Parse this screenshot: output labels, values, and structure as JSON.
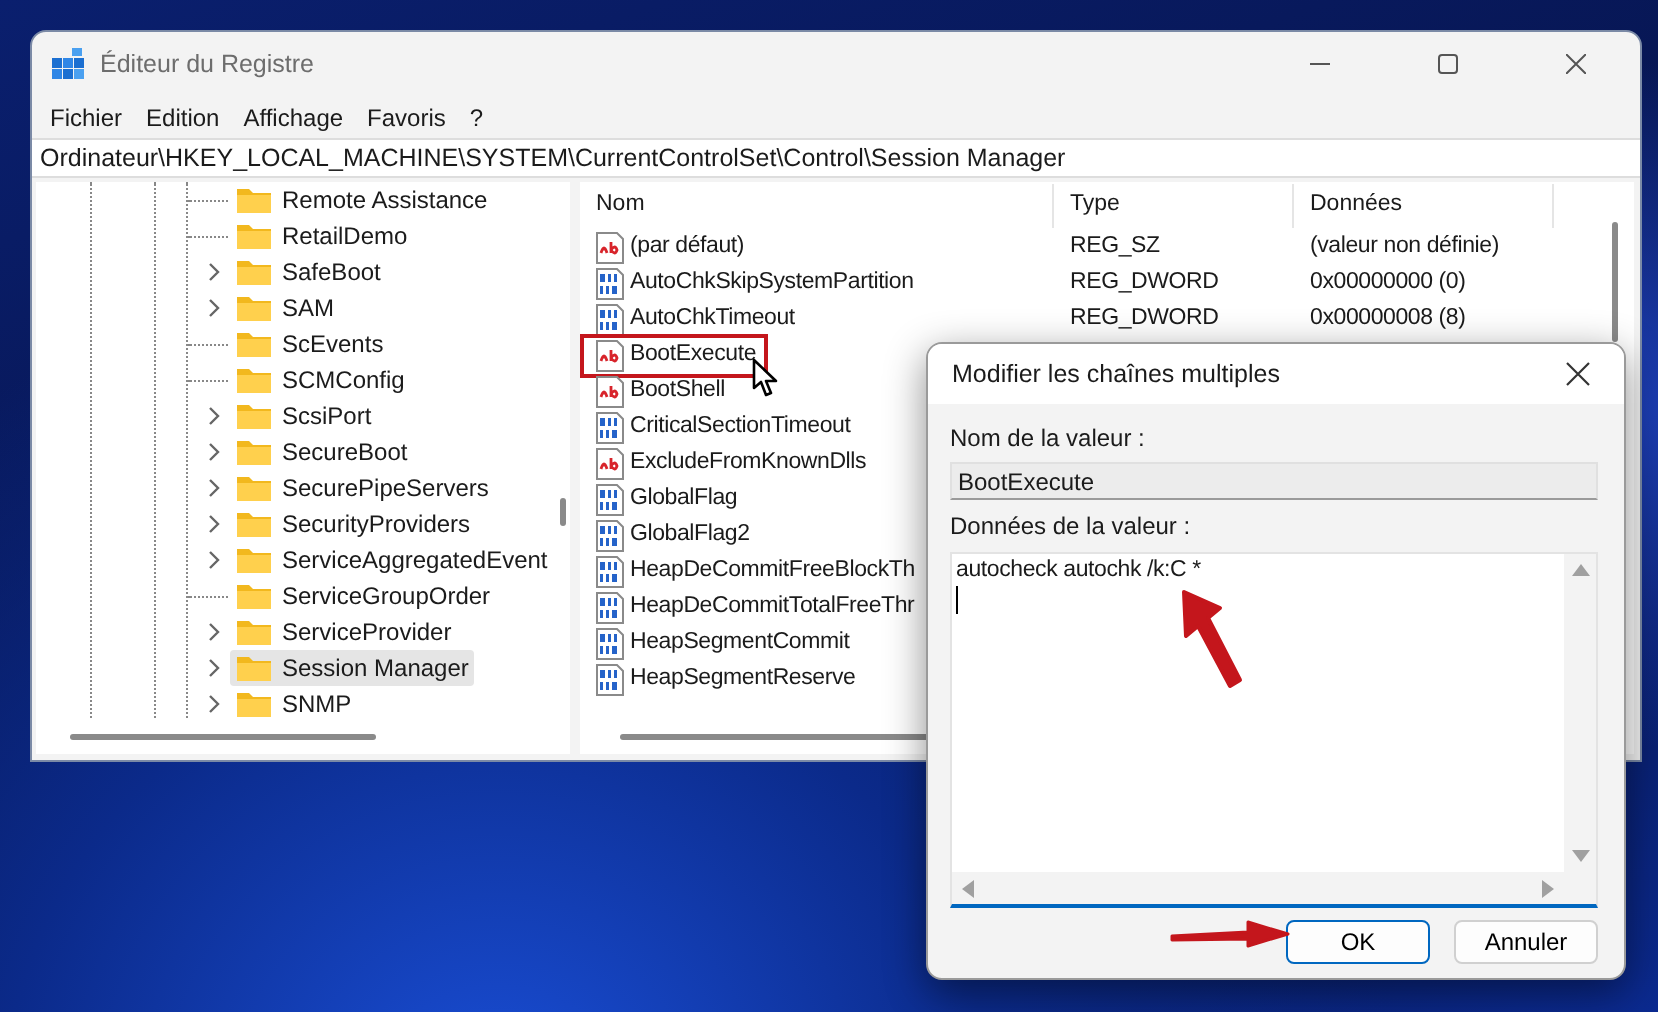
{
  "window": {
    "title": "Éditeur du Registre"
  },
  "menu": [
    "Fichier",
    "Edition",
    "Affichage",
    "Favoris",
    "?"
  ],
  "address_bar": {
    "value": "Ordinateur\\HKEY_LOCAL_MACHINE\\SYSTEM\\CurrentControlSet\\Control\\Session Manager"
  },
  "tree": {
    "items": [
      {
        "label": "Remote Assistance",
        "expandable": false,
        "selected": false
      },
      {
        "label": "RetailDemo",
        "expandable": false,
        "selected": false
      },
      {
        "label": "SafeBoot",
        "expandable": true,
        "selected": false
      },
      {
        "label": "SAM",
        "expandable": true,
        "selected": false
      },
      {
        "label": "ScEvents",
        "expandable": false,
        "selected": false
      },
      {
        "label": "SCMConfig",
        "expandable": false,
        "selected": false
      },
      {
        "label": "ScsiPort",
        "expandable": true,
        "selected": false
      },
      {
        "label": "SecureBoot",
        "expandable": true,
        "selected": false
      },
      {
        "label": "SecurePipeServers",
        "expandable": true,
        "selected": false
      },
      {
        "label": "SecurityProviders",
        "expandable": true,
        "selected": false
      },
      {
        "label": "ServiceAggregatedEvent",
        "expandable": true,
        "selected": false
      },
      {
        "label": "ServiceGroupOrder",
        "expandable": false,
        "selected": false
      },
      {
        "label": "ServiceProvider",
        "expandable": true,
        "selected": false
      },
      {
        "label": "Session Manager",
        "expandable": true,
        "selected": true
      },
      {
        "label": "SNMP",
        "expandable": true,
        "selected": false
      }
    ]
  },
  "values": {
    "columns": [
      "Nom",
      "Type",
      "Données"
    ],
    "rows": [
      {
        "kind": "string",
        "name": "(par défaut)",
        "type": "REG_SZ",
        "data": "(valeur non définie)",
        "highlighted": false
      },
      {
        "kind": "binary",
        "name": "AutoChkSkipSystemPartition",
        "type": "REG_DWORD",
        "data": "0x00000000 (0)",
        "highlighted": false
      },
      {
        "kind": "binary",
        "name": "AutoChkTimeout",
        "type": "REG_DWORD",
        "data": "0x00000008 (8)",
        "highlighted": false
      },
      {
        "kind": "string",
        "name": "BootExecute",
        "highlighted": true
      },
      {
        "kind": "string",
        "name": "BootShell",
        "highlighted": false
      },
      {
        "kind": "binary",
        "name": "CriticalSectionTimeout",
        "highlighted": false
      },
      {
        "kind": "string",
        "name": "ExcludeFromKnownDlls",
        "highlighted": false
      },
      {
        "kind": "binary",
        "name": "GlobalFlag",
        "highlighted": false
      },
      {
        "kind": "binary",
        "name": "GlobalFlag2",
        "highlighted": false
      },
      {
        "kind": "binary",
        "name": "HeapDeCommitFreeBlockTh",
        "highlighted": false
      },
      {
        "kind": "binary",
        "name": "HeapDeCommitTotalFreeThr",
        "highlighted": false
      },
      {
        "kind": "binary",
        "name": "HeapSegmentCommit",
        "highlighted": false
      },
      {
        "kind": "binary",
        "name": "HeapSegmentReserve",
        "highlighted": false
      }
    ]
  },
  "dialog": {
    "title": "Modifier les chaînes multiples",
    "name_label": "Nom de la valeur :",
    "name_value": "BootExecute",
    "data_label": "Données de la valeur :",
    "data_value": "autocheck autochk /k:C *",
    "buttons": [
      {
        "label": "OK",
        "default": true
      },
      {
        "label": "Annuler",
        "default": false
      }
    ]
  }
}
